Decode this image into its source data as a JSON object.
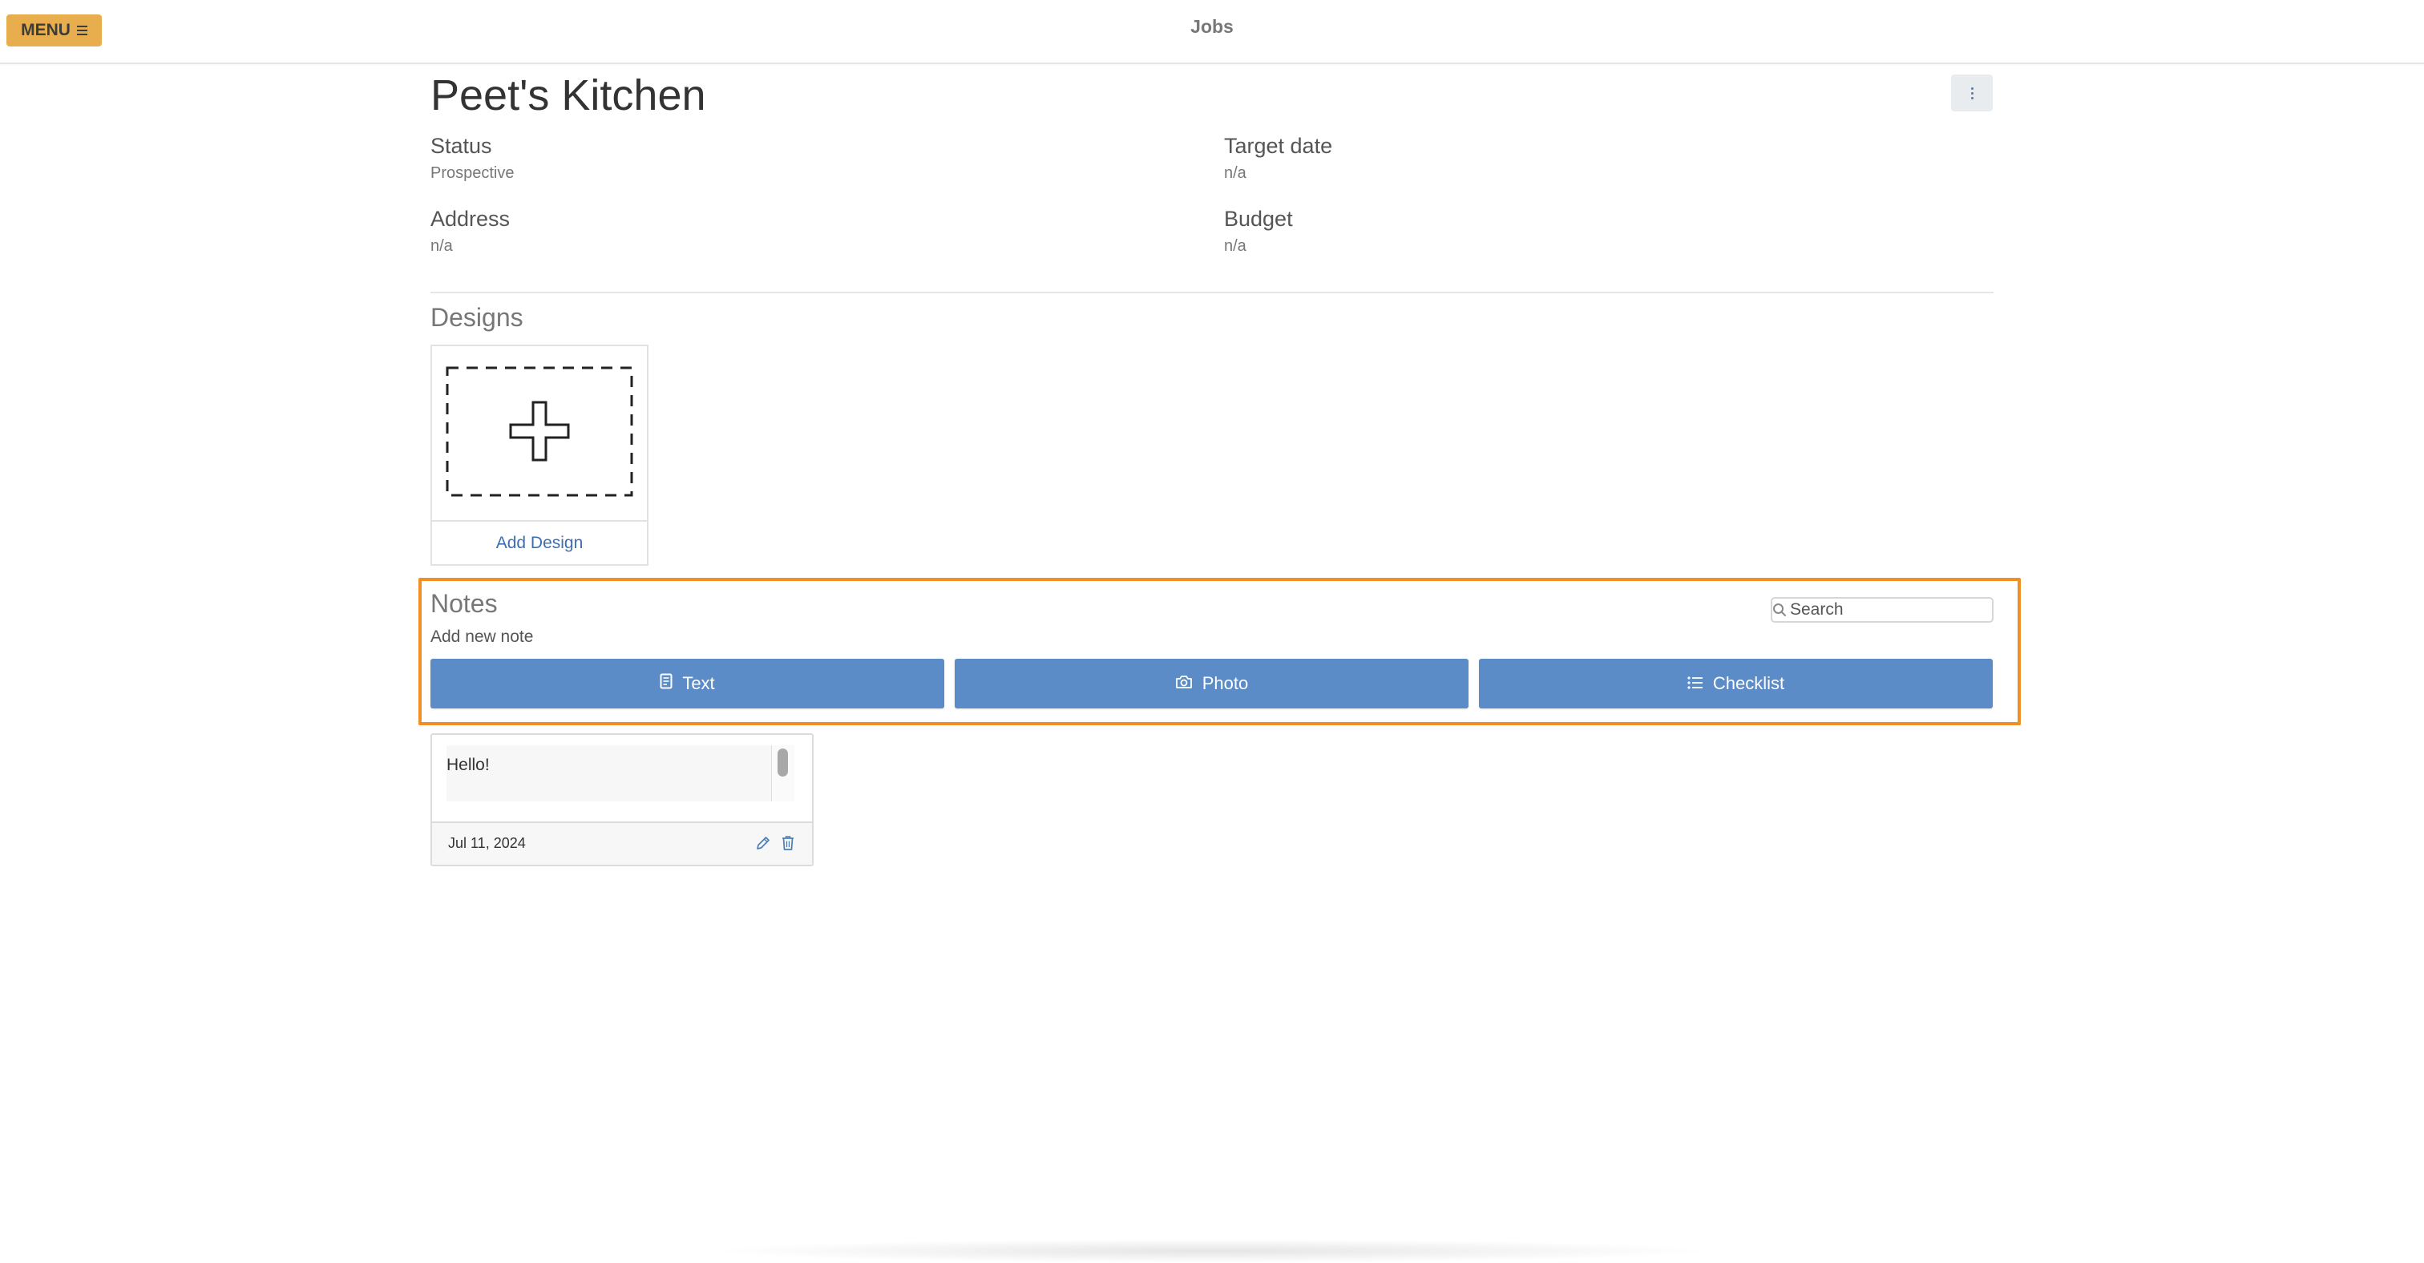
{
  "topbar": {
    "menu_label": "MENU",
    "title": "Jobs"
  },
  "job": {
    "title": "Peet's Kitchen",
    "fields": {
      "status_label": "Status",
      "status_value": "Prospective",
      "target_date_label": "Target date",
      "target_date_value": "n/a",
      "address_label": "Address",
      "address_value": "n/a",
      "budget_label": "Budget",
      "budget_value": "n/a"
    }
  },
  "designs": {
    "title": "Designs",
    "add_label": "Add Design"
  },
  "notes": {
    "title": "Notes",
    "add_new_label": "Add new note",
    "search_placeholder": "Search",
    "buttons": {
      "text": "Text",
      "photo": "Photo",
      "checklist": "Checklist"
    },
    "items": [
      {
        "text": "Hello!",
        "date": "Jul 11, 2024"
      }
    ]
  },
  "colors": {
    "menu_button": "#e8ae4d",
    "primary_button": "#5b8cc7",
    "highlight_border": "#f08f22",
    "link": "#3c6fb0"
  },
  "icons": {
    "menu": "hamburger-icon",
    "more": "vertical-dots-icon",
    "search": "search-icon",
    "add_design": "plus-icon",
    "text_note": "document-icon",
    "photo_note": "camera-icon",
    "checklist_note": "list-icon",
    "edit": "pencil-icon",
    "delete": "trash-icon"
  }
}
